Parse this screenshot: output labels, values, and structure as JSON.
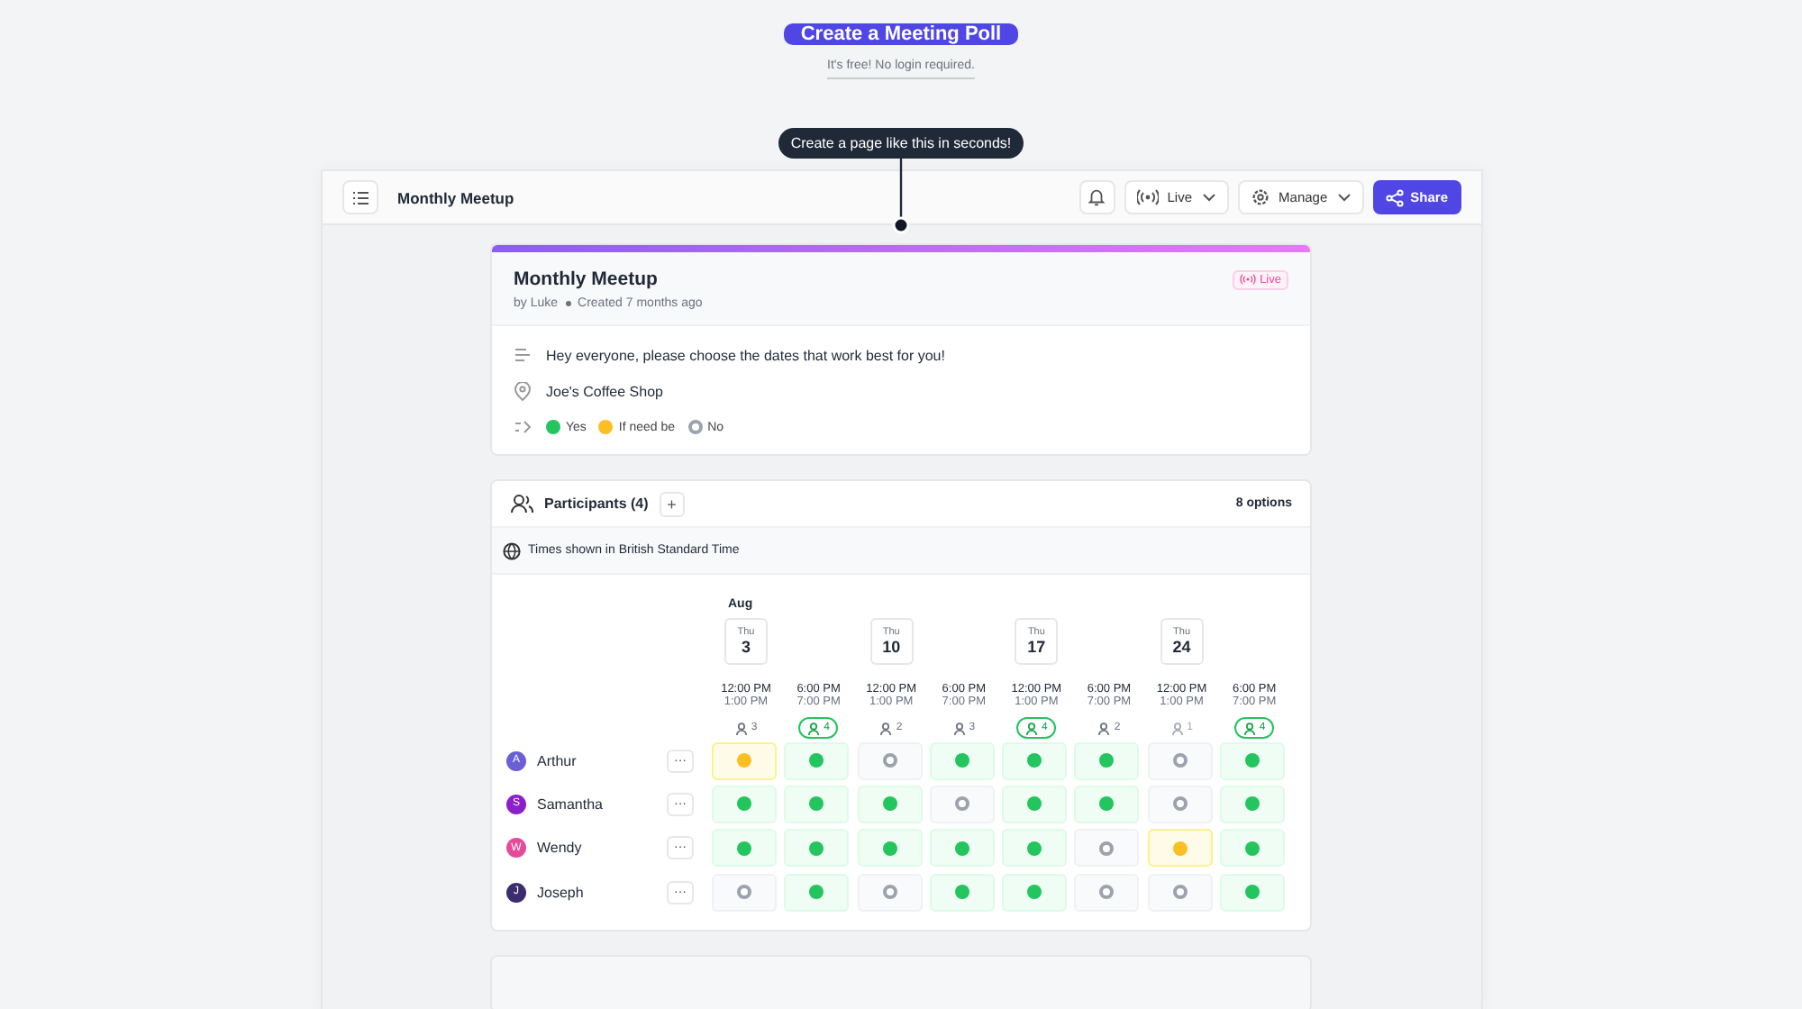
{
  "cta": {
    "label": "Create a Meeting Poll",
    "note": "It's free! No login required."
  },
  "tooltip": "Create a page like this in seconds!",
  "header": {
    "title": "Monthly Meetup",
    "live": "Live",
    "manage": "Manage",
    "share": "Share"
  },
  "poll": {
    "title": "Monthly Meetup",
    "badge": "Live",
    "author": "by Luke",
    "created": "Created 7 months ago",
    "description": "Hey everyone, please choose the dates that work best for you!",
    "location": "Joe's Coffee Shop",
    "legend": [
      {
        "kind": "yes",
        "label": "Yes"
      },
      {
        "kind": "maybe",
        "label": "If need be"
      },
      {
        "kind": "no",
        "label": "No"
      }
    ]
  },
  "participants": {
    "title": "Participants (4)",
    "add": "+",
    "options": "8 options",
    "timezone": "Times shown in British Standard Time",
    "month": "Aug",
    "columns": [
      {
        "weekday": "Thu",
        "day": "3",
        "start": "12:00 PM",
        "end": "1:00 PM",
        "count": "3",
        "top": false
      },
      {
        "start": "6:00 PM",
        "end": "7:00 PM",
        "count": "4",
        "top": true
      },
      {
        "weekday": "Thu",
        "day": "10",
        "start": "12:00 PM",
        "end": "1:00 PM",
        "count": "2",
        "top": false
      },
      {
        "start": "6:00 PM",
        "end": "7:00 PM",
        "count": "3",
        "top": false
      },
      {
        "weekday": "Thu",
        "day": "17",
        "start": "12:00 PM",
        "end": "1:00 PM",
        "count": "4",
        "top": true
      },
      {
        "start": "6:00 PM",
        "end": "7:00 PM",
        "count": "2",
        "top": false
      },
      {
        "weekday": "Thu",
        "day": "24",
        "start": "12:00 PM",
        "end": "1:00 PM",
        "count": "1",
        "top": false
      },
      {
        "start": "6:00 PM",
        "end": "7:00 PM",
        "count": "4",
        "top": true
      }
    ],
    "people": [
      {
        "initial": "A",
        "name": "Arthur",
        "color": "#6b5fd6",
        "more": "···",
        "votes": [
          {
            "kind": "maybe"
          },
          {
            "kind": "yes"
          },
          {
            "kind": "no"
          },
          {
            "kind": "yes"
          },
          {
            "kind": "yes"
          },
          {
            "kind": "yes"
          },
          {
            "kind": "no"
          },
          {
            "kind": "yes"
          }
        ]
      },
      {
        "initial": "S",
        "name": "Samantha",
        "color": "#8b1fc9",
        "more": "···",
        "votes": [
          {
            "kind": "yes"
          },
          {
            "kind": "yes"
          },
          {
            "kind": "yes"
          },
          {
            "kind": "no"
          },
          {
            "kind": "yes"
          },
          {
            "kind": "yes"
          },
          {
            "kind": "no"
          },
          {
            "kind": "yes"
          }
        ]
      },
      {
        "initial": "W",
        "name": "Wendy",
        "color": "#e64b9a",
        "more": "···",
        "votes": [
          {
            "kind": "yes"
          },
          {
            "kind": "yes"
          },
          {
            "kind": "yes"
          },
          {
            "kind": "yes"
          },
          {
            "kind": "yes"
          },
          {
            "kind": "no"
          },
          {
            "kind": "maybe"
          },
          {
            "kind": "yes"
          }
        ]
      },
      {
        "initial": "J",
        "name": "Joseph",
        "color": "#3b2d6e",
        "more": "···",
        "votes": [
          {
            "kind": "no"
          },
          {
            "kind": "yes"
          },
          {
            "kind": "no"
          },
          {
            "kind": "yes"
          },
          {
            "kind": "yes"
          },
          {
            "kind": "no"
          },
          {
            "kind": "no"
          },
          {
            "kind": "yes"
          }
        ]
      }
    ]
  }
}
